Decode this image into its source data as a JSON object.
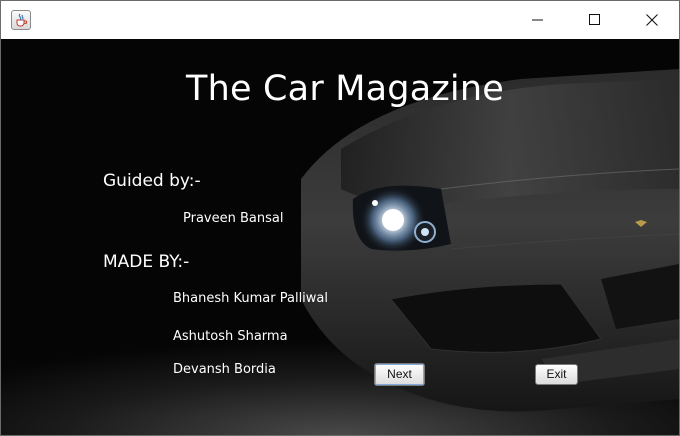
{
  "window": {
    "title": "",
    "icon": "java-cup-icon",
    "controls": [
      "minimize-icon",
      "maximize-icon",
      "close-icon"
    ]
  },
  "main": {
    "heading": "The Car Magazine",
    "guided_label": "Guided by:-",
    "guide_name": "Praveen Bansal",
    "made_label": "MADE BY:-",
    "authors": [
      "Bhanesh Kumar Palliwal",
      "Ashutosh Sharma",
      "Devansh Bordia"
    ],
    "next_label": "Next",
    "exit_label": "Exit"
  },
  "colors": {
    "background": "#050505",
    "text": "#ffffff",
    "titlebar": "#ffffff"
  }
}
